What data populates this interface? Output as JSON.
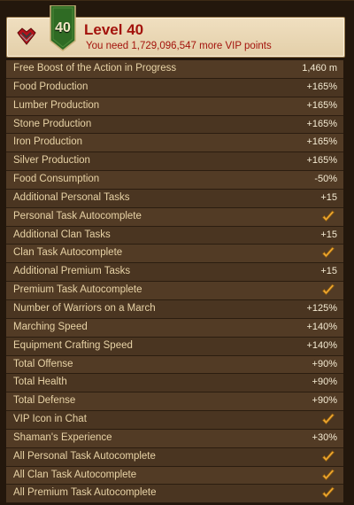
{
  "header": {
    "level_number": "40",
    "level_title": "Level 40",
    "vip_message": "You need 1,729,096,547 more VIP points"
  },
  "bonuses": [
    {
      "label": "Free Boost of the Action in Progress",
      "value": "1,460 m",
      "checked": false
    },
    {
      "label": "Food Production",
      "value": "+165%",
      "checked": false
    },
    {
      "label": "Lumber Production",
      "value": "+165%",
      "checked": false
    },
    {
      "label": "Stone Production",
      "value": "+165%",
      "checked": false
    },
    {
      "label": "Iron Production",
      "value": "+165%",
      "checked": false
    },
    {
      "label": "Silver Production",
      "value": "+165%",
      "checked": false
    },
    {
      "label": "Food Consumption",
      "value": "-50%",
      "checked": false
    },
    {
      "label": "Additional Personal Tasks",
      "value": "+15",
      "checked": false
    },
    {
      "label": "Personal Task Autocomplete",
      "value": "",
      "checked": true
    },
    {
      "label": "Additional Clan Tasks",
      "value": "+15",
      "checked": false
    },
    {
      "label": "Clan Task Autocomplete",
      "value": "",
      "checked": true
    },
    {
      "label": "Additional Premium Tasks",
      "value": "+15",
      "checked": false
    },
    {
      "label": "Premium Task Autocomplete",
      "value": "",
      "checked": true
    },
    {
      "label": "Number of Warriors on a March",
      "value": "+125%",
      "checked": false
    },
    {
      "label": "Marching Speed",
      "value": "+140%",
      "checked": false
    },
    {
      "label": "Equipment Crafting Speed",
      "value": "+140%",
      "checked": false
    },
    {
      "label": "Total Offense",
      "value": "+90%",
      "checked": false
    },
    {
      "label": "Total Health",
      "value": "+90%",
      "checked": false
    },
    {
      "label": "Total Defense",
      "value": "+90%",
      "checked": false
    },
    {
      "label": "VIP Icon in Chat",
      "value": "",
      "checked": true
    },
    {
      "label": "Shaman's Experience",
      "value": "+30%",
      "checked": false
    },
    {
      "label": "All Personal Task Autocomplete",
      "value": "",
      "checked": true
    },
    {
      "label": "All Clan Task Autocomplete",
      "value": "",
      "checked": true
    },
    {
      "label": "All Premium Task Autocomplete",
      "value": "",
      "checked": true
    }
  ],
  "colors": {
    "title_red": "#a3130c",
    "shield_green": "#2f6b24",
    "check_orange": "#f0a830"
  },
  "icons": {
    "vip": "vip-crown-icon",
    "check": "checkmark-icon"
  }
}
